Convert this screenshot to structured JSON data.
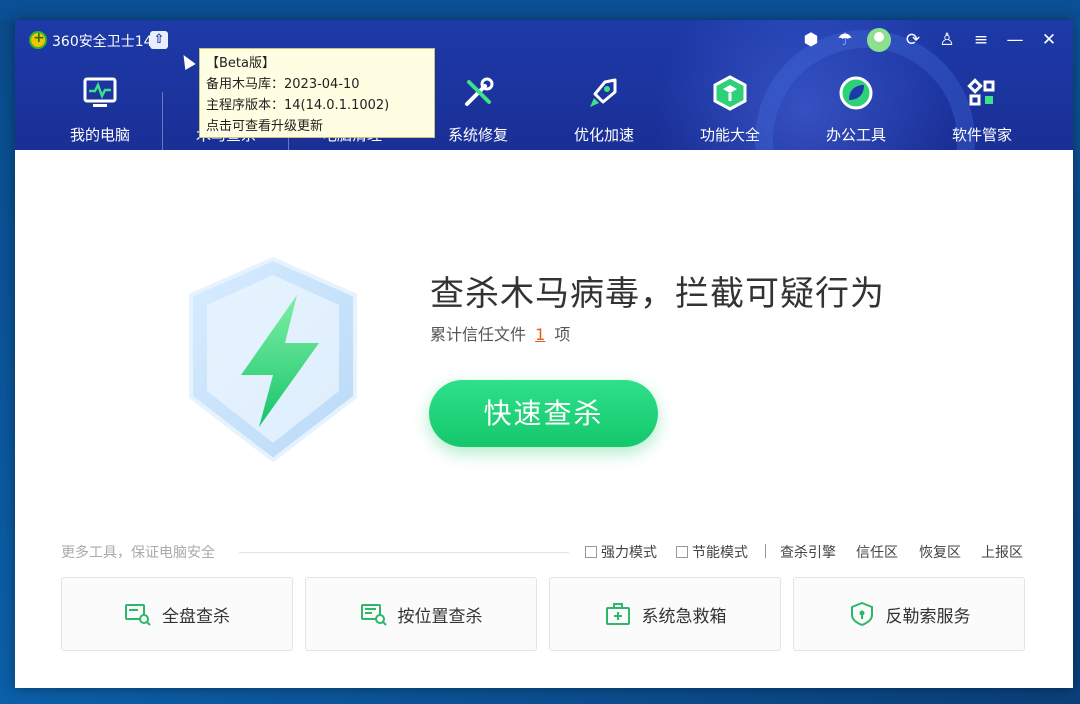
{
  "app": {
    "title": "360安全卫士14",
    "upgrade_icon": "arrow-up-icon"
  },
  "tooltip": {
    "line1": "【Beta版】",
    "line2": "备用木马库：2023-04-10",
    "line3": "主程序版本：14(14.0.1.1002)",
    "line4": "点击可查看升级更新"
  },
  "titlebar_icons": [
    "shield-badge-icon",
    "umbrella-icon",
    "avatar",
    "refresh-icon",
    "shirt-icon",
    "menu-icon",
    "minimize-icon",
    "close-icon"
  ],
  "nav": {
    "items": [
      {
        "label": "我的电脑",
        "icon": "monitor-icon"
      },
      {
        "label": "木马查杀",
        "icon": "shield-icon"
      },
      {
        "label": "电脑清理",
        "icon": "broom-icon"
      },
      {
        "label": "系统修复",
        "icon": "tools-icon"
      },
      {
        "label": "优化加速",
        "icon": "rocket-icon"
      },
      {
        "label": "功能大全",
        "icon": "cube-icon"
      },
      {
        "label": "办公工具",
        "icon": "leaf-icon"
      },
      {
        "label": "软件管家",
        "icon": "apps-icon"
      }
    ]
  },
  "main": {
    "headline": "查杀木马病毒，拦截可疑行为",
    "trust_prefix": "累计信任文件",
    "trust_count": "1",
    "trust_suffix": "项",
    "scan_button": "快速查杀"
  },
  "tools_bar": {
    "more_tools": "更多工具，保证电脑安全",
    "options": [
      "强力模式",
      "节能模式"
    ],
    "links": [
      "查杀引擎",
      "信任区",
      "恢复区",
      "上报区"
    ]
  },
  "tool_cards": [
    {
      "label": "全盘查杀",
      "icon": "disk-scan-icon"
    },
    {
      "label": "按位置查杀",
      "icon": "folder-scan-icon"
    },
    {
      "label": "系统急救箱",
      "icon": "first-aid-kit-icon"
    },
    {
      "label": "反勒索服务",
      "icon": "shield-lock-icon"
    }
  ],
  "colors": {
    "header": "#1d3aa8",
    "accent_green": "#15c76b",
    "count_orange": "#e55b1a"
  }
}
